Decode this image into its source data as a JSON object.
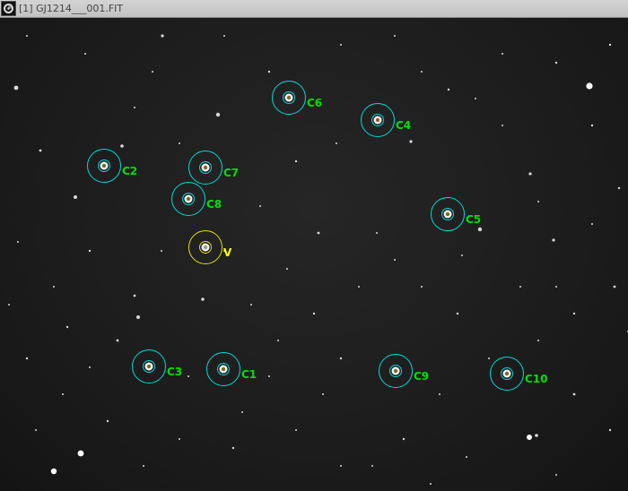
{
  "window": {
    "title": "[1] GJ1214___001.FIT"
  },
  "colors": {
    "comparison": "#00e000",
    "variable": "#ffff00",
    "aperture_comparison": "#00d8d8",
    "aperture_variable": "#e0e000"
  },
  "icons": {
    "app": "camera-lens-icon"
  },
  "photometry": {
    "apertures": [
      {
        "label": "C6",
        "kind": "comparison"
      },
      {
        "label": "C4",
        "kind": "comparison"
      },
      {
        "label": "C2",
        "kind": "comparison"
      },
      {
        "label": "C7",
        "kind": "comparison"
      },
      {
        "label": "C8",
        "kind": "comparison"
      },
      {
        "label": "C5",
        "kind": "comparison"
      },
      {
        "label": "V",
        "kind": "variable"
      },
      {
        "label": "C3",
        "kind": "comparison"
      },
      {
        "label": "C1",
        "kind": "comparison"
      },
      {
        "label": "C9",
        "kind": "comparison"
      },
      {
        "label": "C10",
        "kind": "comparison"
      }
    ]
  }
}
